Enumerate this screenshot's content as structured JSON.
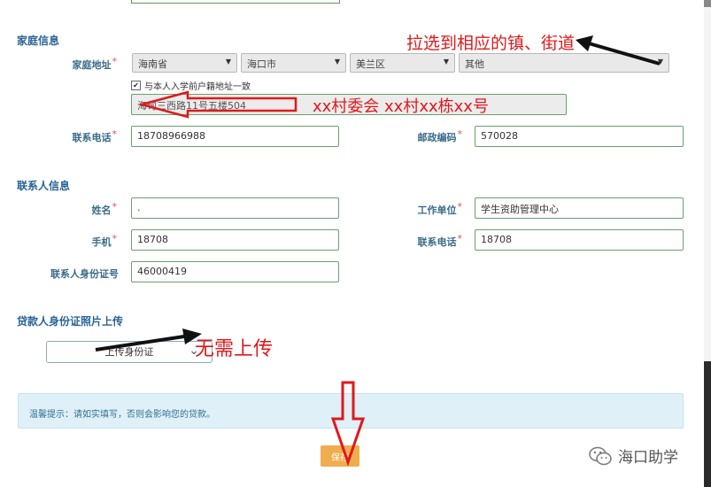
{
  "family": {
    "section_title": "家庭信息",
    "address_label": "家庭地址",
    "province": "海南省",
    "city": "海口市",
    "district": "美兰区",
    "town": "其他",
    "same_checkbox_label": "与本人入学前户籍地址一致",
    "address_detail": "海甸三西路11号五楼504",
    "phone_label": "联系电话",
    "phone_value": "18708966988",
    "postcode_label": "邮政编码",
    "postcode_value": "570028"
  },
  "contact": {
    "section_title": "联系人信息",
    "name_label": "姓名",
    "name_value": ".",
    "work_label": "工作单位",
    "work_value": "学生资助管理中心",
    "mobile_label": "手机",
    "mobile_value": "18708",
    "phone_label": "联系电话",
    "phone_value": "18708",
    "id_label": "联系人身份证号",
    "id_value": "46000419"
  },
  "upload": {
    "section_title": "贷款人身份证照片上传",
    "button_label": "上传身份证"
  },
  "tip_text": "温馨提示：请如实填写，否则会影响您的贷款。",
  "save_label": "保存",
  "annotations": {
    "select_hint": "拉选到相应的镇、街道",
    "address_hint": "xx村委会 xx村xx栋xx号",
    "upload_hint": "无需上传"
  },
  "watermark": "海口助学",
  "colors": {
    "annotation_red": "#e0181b",
    "label_blue": "#3a6b8a",
    "input_border": "#6aa06a",
    "button_orange": "#f0ad4e",
    "tip_bg": "#dff0f8"
  },
  "icons": [
    "caret-down-icon",
    "checkbox-checked-icon",
    "chevron-down-icon",
    "wechat-icon"
  ]
}
